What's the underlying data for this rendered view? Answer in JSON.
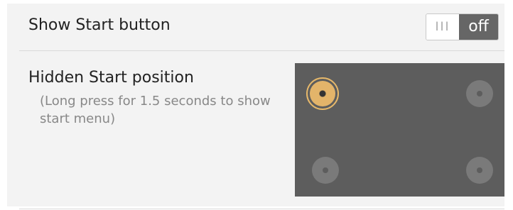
{
  "show_start": {
    "label": "Show Start button",
    "toggle": {
      "handle_glyph": "III",
      "state_label": "off",
      "colors": {
        "track": "#666666",
        "handle": "#ffffff"
      }
    }
  },
  "hidden_start_position": {
    "label": "Hidden Start position",
    "hint": "(Long press for 1.5 seconds to show start menu)",
    "selected": "top-left",
    "positions": [
      "top-left",
      "top-right",
      "bottom-left",
      "bottom-right"
    ],
    "colors": {
      "area": "#5d5d5d",
      "selected": "#e3b46a",
      "unselected": "#7a7a7a"
    }
  }
}
